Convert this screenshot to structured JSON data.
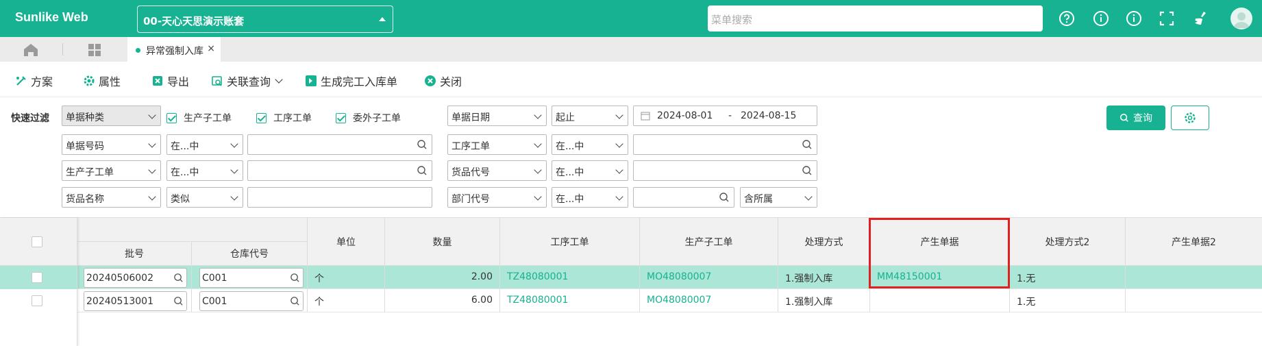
{
  "header": {
    "brand": "Sunlike Web",
    "account": "00-天心天思演示账套",
    "search_placeholder": "菜单搜索",
    "icons": [
      "help-circle-icon",
      "info-icon",
      "info-outline-icon",
      "fullscreen-icon",
      "clean-icon",
      "avatar"
    ]
  },
  "tabs": {
    "active_label": "异常强制入库",
    "close": "×"
  },
  "toolbar": {
    "scheme": "方案",
    "properties": "属性",
    "export": "导出",
    "related_query": "关联查询",
    "generate": "生成完工入库单",
    "close": "关闭"
  },
  "filter": {
    "quick_filter": "快速过滤",
    "doc_type_select": "单据种类",
    "cb1": "生产子工单",
    "cb2": "工序工单",
    "cb3": "委外子工单",
    "date_field": "单据日期",
    "date_range_op": "起止",
    "date_from": "2024-08-01",
    "date_sep": "-",
    "date_to": "2024-08-15",
    "r2_field_a": "单据号码",
    "r2_op_a": "在...中",
    "r2_field_b": "工序工单",
    "r2_op_b": "在...中",
    "r3_field_a": "生产子工单",
    "r3_op_a": "在...中",
    "r3_field_b": "货品代号",
    "r3_op_b": "在...中",
    "r4_field_a": "货品名称",
    "r4_op_a": "类似",
    "r4_field_b": "部门代号",
    "r4_op_b": "在...中",
    "r4_extra": "含所属",
    "query_btn": "查询"
  },
  "grid": {
    "headers": {
      "batch": "批号",
      "warehouse": "仓库代号",
      "unit": "单位",
      "qty": "数量",
      "process_order": "工序工单",
      "sub_order": "生产子工单",
      "method": "处理方式",
      "generated": "产生单据",
      "method2": "处理方式2",
      "generated2": "产生单据2"
    },
    "rows": [
      {
        "batch": "20240506002",
        "warehouse": "C001",
        "unit": "个",
        "qty": "2.00",
        "process_order": "TZ48080001",
        "sub_order": "MO48080007",
        "method": "1.强制入库",
        "generated": "MM48150001",
        "method2": "1.无",
        "generated2": ""
      },
      {
        "batch": "20240513001",
        "warehouse": "C001",
        "unit": "个",
        "qty": "6.00",
        "process_order": "TZ48080001",
        "sub_order": "MO48080007",
        "method": "1.强制入库",
        "generated": "",
        "method2": "1.无",
        "generated2": ""
      }
    ]
  },
  "colors": {
    "brand": "#17b291",
    "selected_row": "#abe6d6",
    "highlight": "#e02020"
  }
}
